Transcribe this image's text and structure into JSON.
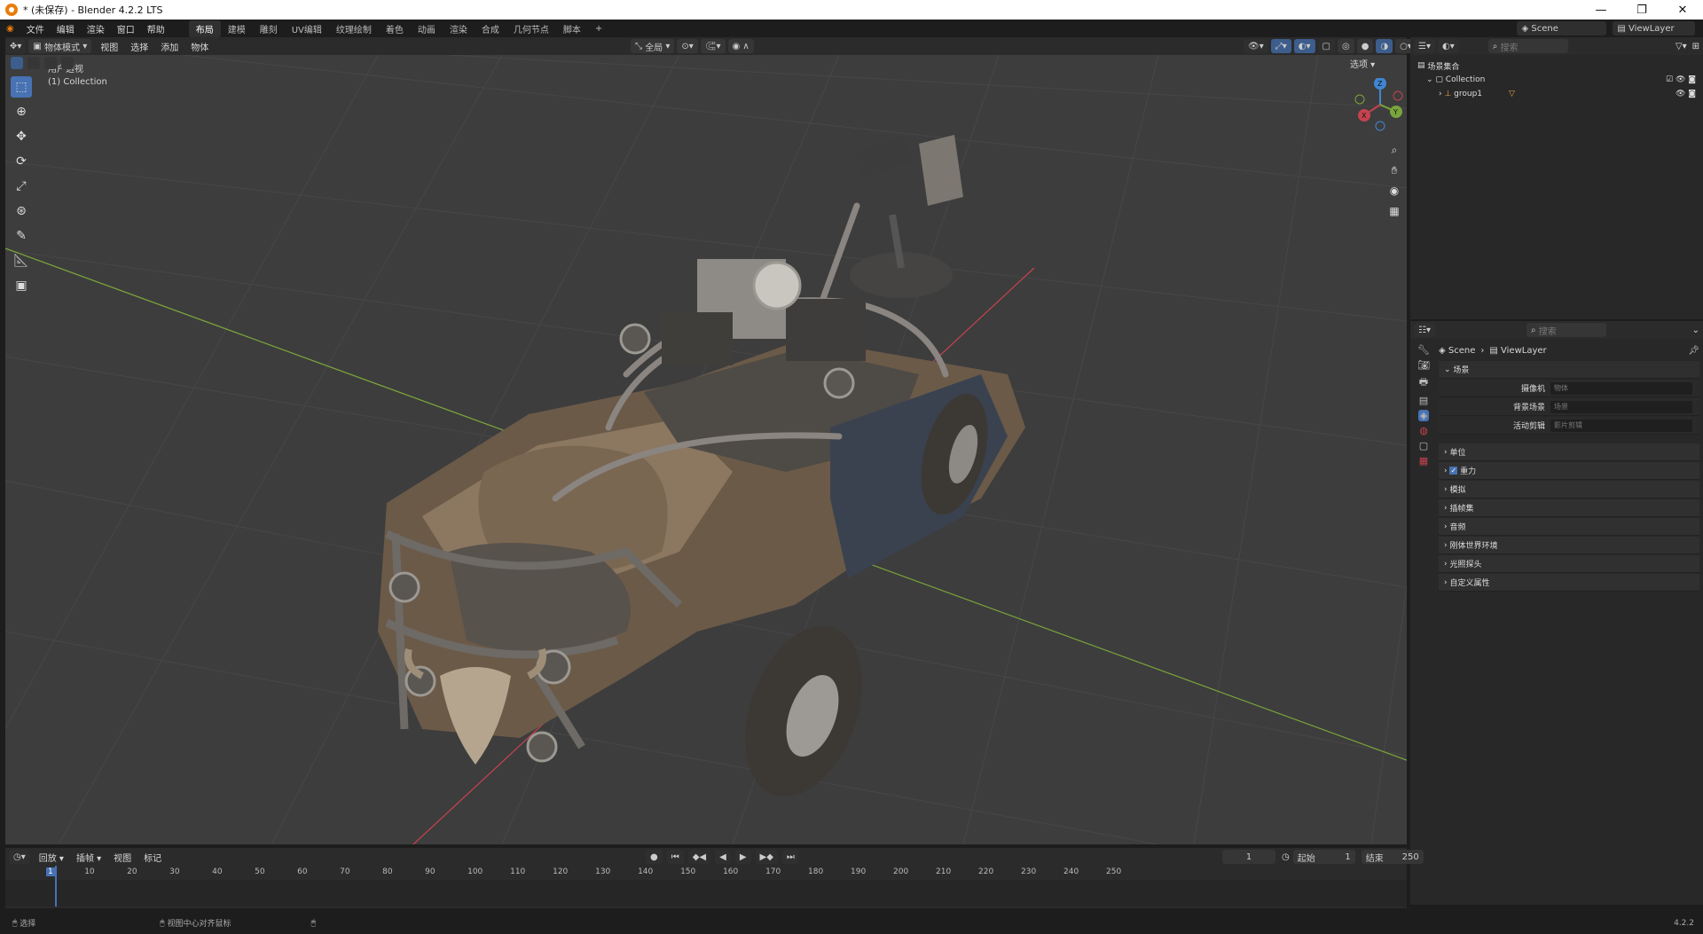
{
  "window": {
    "title": "* (未保存) - Blender 4.2.2 LTS",
    "min": "—",
    "restore": "❐",
    "close": "✕"
  },
  "menu": [
    "文件",
    "编辑",
    "渲染",
    "窗口",
    "帮助"
  ],
  "workspaces": [
    "布局",
    "建模",
    "雕刻",
    "UV编辑",
    "纹理绘制",
    "着色",
    "动画",
    "渲染",
    "合成",
    "几何节点",
    "脚本"
  ],
  "active_workspace": "布局",
  "scene_name": "Scene",
  "viewlayer_name": "ViewLayer",
  "viewport": {
    "mode": "物体模式",
    "menus": [
      "视图",
      "选择",
      "添加",
      "物体"
    ],
    "transform_orientation": "全局",
    "options_label": "选项",
    "overlay_text": [
      "用户透视",
      "(1) Collection"
    ],
    "gizmo": {
      "x": "X",
      "y": "Y",
      "z": "Z"
    }
  },
  "outliner": {
    "search_placeholder": "搜索",
    "root": "场景集合",
    "collection": "Collection",
    "object": "group1"
  },
  "properties": {
    "search_placeholder": "搜索",
    "breadcrumb": [
      "Scene",
      "ViewLayer"
    ],
    "panel_title": "场景",
    "fields": [
      {
        "label": "摄像机",
        "placeholder": "物体"
      },
      {
        "label": "背景场景",
        "placeholder": "场景"
      },
      {
        "label": "活动剪辑",
        "placeholder": "影片剪辑"
      }
    ],
    "sections": [
      "单位",
      "重力",
      "模拟",
      "插帧集",
      "音频",
      "刚体世界环境",
      "光照探头",
      "自定义属性"
    ],
    "gravity_checked": true
  },
  "timeline": {
    "menus": [
      "回放",
      "插帧",
      "视图",
      "标记"
    ],
    "current_frame": "1",
    "start_label": "起始",
    "start": "1",
    "end_label": "结束",
    "end": "250",
    "ticks": [
      "1",
      "10",
      "20",
      "30",
      "40",
      "50",
      "60",
      "70",
      "80",
      "90",
      "100",
      "110",
      "120",
      "130",
      "140",
      "150",
      "160",
      "170",
      "180",
      "190",
      "200",
      "210",
      "220",
      "230",
      "240",
      "250"
    ]
  },
  "status": {
    "left": "选择",
    "middle": "视图中心对齐鼠标",
    "version": "4.2.2"
  },
  "colors": {
    "accent": "#4772b3",
    "x_axis": "#c5434f",
    "y_axis": "#7aa53b",
    "z_axis": "#3f86d4"
  }
}
